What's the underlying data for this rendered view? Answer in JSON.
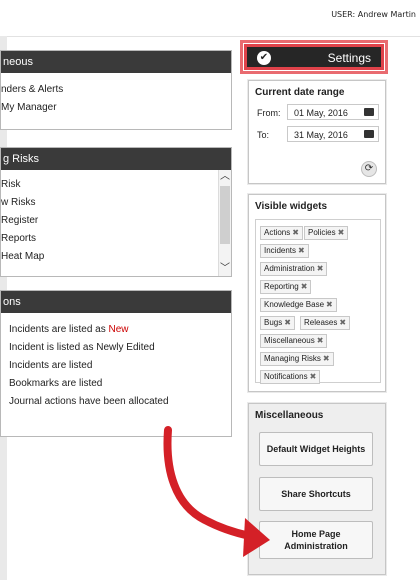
{
  "topbar": {
    "user": "USER: Andrew Martin"
  },
  "panels": [
    {
      "title": "neous",
      "items": [
        "nders & Alerts",
        "My Manager"
      ]
    },
    {
      "title": "g Risks",
      "items": [
        "Risk",
        "w Risks",
        "Register",
        "Reports",
        "Heat Map"
      ]
    },
    {
      "title": "ons",
      "items": [
        "Incidents are listed as ",
        "Incident is listed as Newly Edited",
        "Incidents are listed",
        "Bookmarks are listed",
        "Journal actions have been allocated"
      ],
      "new_word": "New"
    }
  ],
  "settings": {
    "label": "Settings",
    "icon": "check-circle-icon",
    "highlight_color": "#e0424a"
  },
  "date_range": {
    "title": "Current date range",
    "from_label": "From:",
    "from_value": "01 May, 2016",
    "to_label": "To:",
    "to_value": "31 May, 2016",
    "calendar_icon": "calendar-icon",
    "refresh_icon": "refresh-icon"
  },
  "widgets": {
    "title": "Visible widgets",
    "tags": [
      "Actions",
      "Policies",
      "Incidents",
      "Administration",
      "Reporting",
      "Knowledge Base",
      "Bugs",
      "Releases",
      "Miscellaneous",
      "Managing Risks",
      "Notifications"
    ],
    "remove_symbol": "✖"
  },
  "misc": {
    "title": "Miscellaneous",
    "buttons": [
      "Default Widget Heights",
      "Share Shortcuts"
    ],
    "home_btn_line1": "Home Page",
    "home_btn_line2": "Administration"
  },
  "annotation": {
    "arrow_color": "#d42027"
  }
}
